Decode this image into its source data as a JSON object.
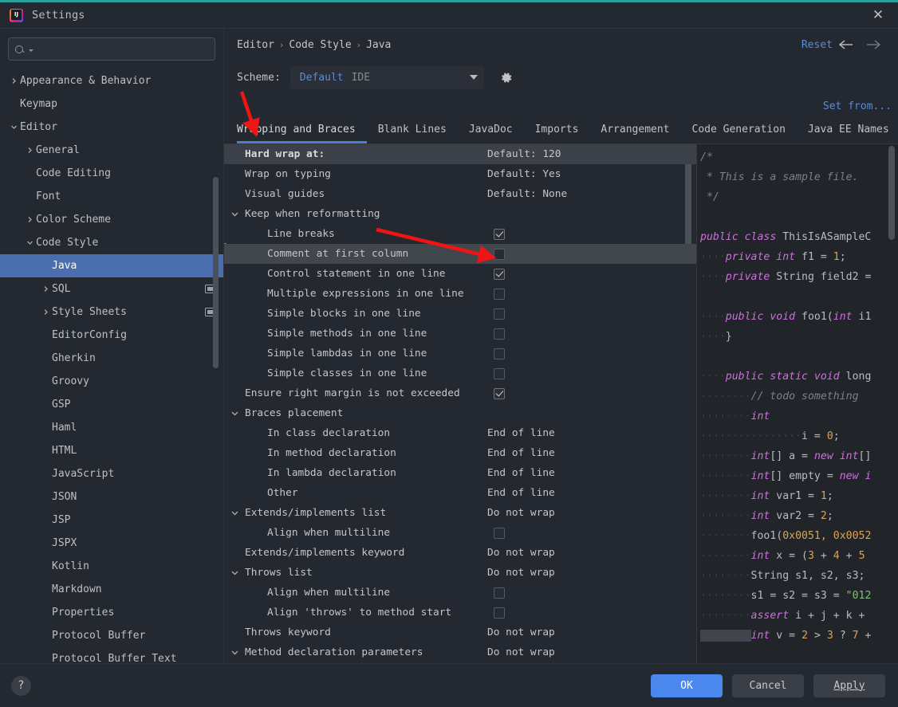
{
  "window": {
    "title": "Settings",
    "logo_icon": "intellij-idea-logo",
    "close_icon": "close-icon"
  },
  "sidebar": {
    "search": {
      "placeholder": "",
      "value": "",
      "icon": "search-icon"
    },
    "items": [
      {
        "label": "Appearance & Behavior",
        "indent": 0,
        "arrow": "right",
        "selected": false
      },
      {
        "label": "Keymap",
        "indent": 0,
        "arrow": "none",
        "selected": false
      },
      {
        "label": "Editor",
        "indent": 0,
        "arrow": "down",
        "selected": false
      },
      {
        "label": "General",
        "indent": 1,
        "arrow": "right",
        "selected": false
      },
      {
        "label": "Code Editing",
        "indent": 1,
        "arrow": "none",
        "selected": false
      },
      {
        "label": "Font",
        "indent": 1,
        "arrow": "none",
        "selected": false
      },
      {
        "label": "Color Scheme",
        "indent": 1,
        "arrow": "right",
        "selected": false
      },
      {
        "label": "Code Style",
        "indent": 1,
        "arrow": "down",
        "selected": false
      },
      {
        "label": "Java",
        "indent": 2,
        "arrow": "none",
        "selected": true
      },
      {
        "label": "SQL",
        "indent": 2,
        "arrow": "right",
        "selected": false,
        "badge": true
      },
      {
        "label": "Style Sheets",
        "indent": 2,
        "arrow": "right",
        "selected": false,
        "badge": true
      },
      {
        "label": "EditorConfig",
        "indent": 2,
        "arrow": "none",
        "selected": false
      },
      {
        "label": "Gherkin",
        "indent": 2,
        "arrow": "none",
        "selected": false
      },
      {
        "label": "Groovy",
        "indent": 2,
        "arrow": "none",
        "selected": false
      },
      {
        "label": "GSP",
        "indent": 2,
        "arrow": "none",
        "selected": false
      },
      {
        "label": "Haml",
        "indent": 2,
        "arrow": "none",
        "selected": false
      },
      {
        "label": "HTML",
        "indent": 2,
        "arrow": "none",
        "selected": false
      },
      {
        "label": "JavaScript",
        "indent": 2,
        "arrow": "none",
        "selected": false
      },
      {
        "label": "JSON",
        "indent": 2,
        "arrow": "none",
        "selected": false
      },
      {
        "label": "JSP",
        "indent": 2,
        "arrow": "none",
        "selected": false
      },
      {
        "label": "JSPX",
        "indent": 2,
        "arrow": "none",
        "selected": false
      },
      {
        "label": "Kotlin",
        "indent": 2,
        "arrow": "none",
        "selected": false
      },
      {
        "label": "Markdown",
        "indent": 2,
        "arrow": "none",
        "selected": false
      },
      {
        "label": "Properties",
        "indent": 2,
        "arrow": "none",
        "selected": false
      },
      {
        "label": "Protocol Buffer",
        "indent": 2,
        "arrow": "none",
        "selected": false
      },
      {
        "label": "Protocol Buffer Text",
        "indent": 2,
        "arrow": "none",
        "selected": false
      }
    ]
  },
  "header": {
    "breadcrumb": [
      "Editor",
      "Code Style",
      "Java"
    ],
    "separator": "›",
    "reset_label": "Reset",
    "back_icon": "arrow-left-icon",
    "forward_icon": "arrow-right-icon",
    "scheme_label": "Scheme:",
    "scheme_name": "Default",
    "scheme_scope": "IDE",
    "scheme_gear_icon": "gear-icon",
    "set_from_label": "Set from..."
  },
  "tabs": {
    "items": [
      {
        "label": "Wrapping and Braces",
        "active": true
      },
      {
        "label": "Blank Lines",
        "active": false
      },
      {
        "label": "JavaDoc",
        "active": false
      },
      {
        "label": "Imports",
        "active": false
      },
      {
        "label": "Arrangement",
        "active": false
      },
      {
        "label": "Code Generation",
        "active": false
      },
      {
        "label": "Java EE Names",
        "active": false
      }
    ],
    "more_icon": "chevron-down-icon"
  },
  "settings_rows": [
    {
      "label": "Hard wrap at:",
      "indent": 0,
      "twisty": "none",
      "value": "Default: 120",
      "control": "text",
      "state": "header-highlight",
      "bold": true
    },
    {
      "label": "Wrap on typing",
      "indent": 0,
      "twisty": "none",
      "value": "Default: Yes",
      "control": "text",
      "state": ""
    },
    {
      "label": "Visual guides",
      "indent": 0,
      "twisty": "none",
      "value": "Default: None",
      "control": "text",
      "state": ""
    },
    {
      "label": "Keep when reformatting",
      "indent": 0,
      "twisty": "down",
      "value": "",
      "control": "none",
      "state": ""
    },
    {
      "label": "Line breaks",
      "indent": 1,
      "twisty": "none",
      "value": "",
      "control": "checkbox",
      "checked": true,
      "state": ""
    },
    {
      "label": "Comment at first column",
      "indent": 1,
      "twisty": "none",
      "value": "",
      "control": "checkbox",
      "checked": false,
      "state": "row-selected"
    },
    {
      "label": "Control statement in one line",
      "indent": 1,
      "twisty": "none",
      "value": "",
      "control": "checkbox",
      "checked": true,
      "state": ""
    },
    {
      "label": "Multiple expressions in one line",
      "indent": 1,
      "twisty": "none",
      "value": "",
      "control": "checkbox",
      "checked": false,
      "state": ""
    },
    {
      "label": "Simple blocks in one line",
      "indent": 1,
      "twisty": "none",
      "value": "",
      "control": "checkbox",
      "checked": false,
      "state": ""
    },
    {
      "label": "Simple methods in one line",
      "indent": 1,
      "twisty": "none",
      "value": "",
      "control": "checkbox",
      "checked": false,
      "state": ""
    },
    {
      "label": "Simple lambdas in one line",
      "indent": 1,
      "twisty": "none",
      "value": "",
      "control": "checkbox",
      "checked": false,
      "state": ""
    },
    {
      "label": "Simple classes in one line",
      "indent": 1,
      "twisty": "none",
      "value": "",
      "control": "checkbox",
      "checked": false,
      "state": ""
    },
    {
      "label": "Ensure right margin is not exceeded",
      "indent": 0,
      "twisty": "none",
      "value": "",
      "control": "checkbox",
      "checked": true,
      "state": ""
    },
    {
      "label": "Braces placement",
      "indent": 0,
      "twisty": "down",
      "value": "",
      "control": "none",
      "state": ""
    },
    {
      "label": "In class declaration",
      "indent": 1,
      "twisty": "none",
      "value": "End of line",
      "control": "text",
      "state": ""
    },
    {
      "label": "In method declaration",
      "indent": 1,
      "twisty": "none",
      "value": "End of line",
      "control": "text",
      "state": ""
    },
    {
      "label": "In lambda declaration",
      "indent": 1,
      "twisty": "none",
      "value": "End of line",
      "control": "text",
      "state": ""
    },
    {
      "label": "Other",
      "indent": 1,
      "twisty": "none",
      "value": "End of line",
      "control": "text",
      "state": ""
    },
    {
      "label": "Extends/implements list",
      "indent": 0,
      "twisty": "down",
      "value": "Do not wrap",
      "control": "text",
      "state": ""
    },
    {
      "label": "Align when multiline",
      "indent": 1,
      "twisty": "none",
      "value": "",
      "control": "checkbox",
      "checked": false,
      "state": ""
    },
    {
      "label": "Extends/implements keyword",
      "indent": 0,
      "twisty": "none",
      "value": "Do not wrap",
      "control": "text",
      "state": ""
    },
    {
      "label": "Throws list",
      "indent": 0,
      "twisty": "down",
      "value": "Do not wrap",
      "control": "text",
      "state": ""
    },
    {
      "label": "Align when multiline",
      "indent": 1,
      "twisty": "none",
      "value": "",
      "control": "checkbox",
      "checked": false,
      "state": ""
    },
    {
      "label": "Align 'throws' to method start",
      "indent": 1,
      "twisty": "none",
      "value": "",
      "control": "checkbox",
      "checked": false,
      "state": ""
    },
    {
      "label": "Throws keyword",
      "indent": 0,
      "twisty": "none",
      "value": "Do not wrap",
      "control": "text",
      "state": ""
    },
    {
      "label": "Method declaration parameters",
      "indent": 0,
      "twisty": "down",
      "value": "Do not wrap",
      "control": "text",
      "state": ""
    }
  ],
  "preview": {
    "lines": [
      [
        {
          "t": "/*",
          "c": "cm"
        }
      ],
      [
        {
          "t": " * This is a sample file.",
          "c": "cm"
        }
      ],
      [
        {
          "t": " */",
          "c": "cm"
        }
      ],
      [
        {
          "t": "",
          "c": "pl"
        }
      ],
      [
        {
          "t": "public class ",
          "c": "k"
        },
        {
          "t": "ThisIsASampleC",
          "c": "pl"
        }
      ],
      [
        {
          "t": "····",
          "c": "dot"
        },
        {
          "t": "private int ",
          "c": "k"
        },
        {
          "t": "f1 = ",
          "c": "pl"
        },
        {
          "t": "1",
          "c": "num"
        },
        {
          "t": ";",
          "c": "pl"
        }
      ],
      [
        {
          "t": "····",
          "c": "dot"
        },
        {
          "t": "private ",
          "c": "k"
        },
        {
          "t": "String field2 =",
          "c": "pl"
        }
      ],
      [
        {
          "t": "",
          "c": "pl"
        }
      ],
      [
        {
          "t": "····",
          "c": "dot"
        },
        {
          "t": "public void ",
          "c": "k"
        },
        {
          "t": "foo1(",
          "c": "pl"
        },
        {
          "t": "int ",
          "c": "k"
        },
        {
          "t": "i1",
          "c": "pl"
        }
      ],
      [
        {
          "t": "····",
          "c": "dot"
        },
        {
          "t": "}",
          "c": "pl"
        }
      ],
      [
        {
          "t": "",
          "c": "pl"
        }
      ],
      [
        {
          "t": "····",
          "c": "dot"
        },
        {
          "t": "public static void ",
          "c": "k"
        },
        {
          "t": "long",
          "c": "pl"
        }
      ],
      [
        {
          "t": "········",
          "c": "dot"
        },
        {
          "t": "// todo something",
          "c": "cm"
        }
      ],
      [
        {
          "t": "········",
          "c": "dot"
        },
        {
          "t": "int",
          "c": "k"
        }
      ],
      [
        {
          "t": "················",
          "c": "dot"
        },
        {
          "t": "i = ",
          "c": "pl"
        },
        {
          "t": "0",
          "c": "num"
        },
        {
          "t": ";",
          "c": "pl"
        }
      ],
      [
        {
          "t": "········",
          "c": "dot"
        },
        {
          "t": "int",
          "c": "k"
        },
        {
          "t": "[] a = ",
          "c": "pl"
        },
        {
          "t": "new int",
          "c": "k"
        },
        {
          "t": "[]",
          "c": "pl"
        }
      ],
      [
        {
          "t": "········",
          "c": "dot"
        },
        {
          "t": "int",
          "c": "k"
        },
        {
          "t": "[] empty = ",
          "c": "pl"
        },
        {
          "t": "new i",
          "c": "k"
        }
      ],
      [
        {
          "t": "········",
          "c": "dot"
        },
        {
          "t": "int ",
          "c": "k"
        },
        {
          "t": "var1 = ",
          "c": "pl"
        },
        {
          "t": "1",
          "c": "num"
        },
        {
          "t": ";",
          "c": "pl"
        }
      ],
      [
        {
          "t": "········",
          "c": "dot"
        },
        {
          "t": "int ",
          "c": "k"
        },
        {
          "t": "var2 = ",
          "c": "pl"
        },
        {
          "t": "2",
          "c": "num"
        },
        {
          "t": ";",
          "c": "pl"
        }
      ],
      [
        {
          "t": "········",
          "c": "dot"
        },
        {
          "t": "foo1(",
          "c": "pl"
        },
        {
          "t": "0x0051, 0x0052",
          "c": "num"
        }
      ],
      [
        {
          "t": "········",
          "c": "dot"
        },
        {
          "t": "int ",
          "c": "k"
        },
        {
          "t": "x = (",
          "c": "pl"
        },
        {
          "t": "3",
          "c": "num"
        },
        {
          "t": " + ",
          "c": "pl"
        },
        {
          "t": "4",
          "c": "num"
        },
        {
          "t": " + ",
          "c": "pl"
        },
        {
          "t": "5",
          "c": "num"
        }
      ],
      [
        {
          "t": "········",
          "c": "dot"
        },
        {
          "t": "String s1, s2, s3;",
          "c": "pl"
        }
      ],
      [
        {
          "t": "········",
          "c": "dot"
        },
        {
          "t": "s1 = s2 = s3 = ",
          "c": "pl"
        },
        {
          "t": "\"012",
          "c": "str"
        }
      ],
      [
        {
          "t": "········",
          "c": "dot"
        },
        {
          "t": "assert ",
          "c": "k"
        },
        {
          "t": "i + j + k + ",
          "c": "pl"
        }
      ],
      [
        {
          "t": "········",
          "c": "dot",
          "sel": true
        },
        {
          "t": "int ",
          "c": "k"
        },
        {
          "t": "v = ",
          "c": "pl"
        },
        {
          "t": "2",
          "c": "num"
        },
        {
          "t": " > ",
          "c": "pl"
        },
        {
          "t": "3",
          "c": "num"
        },
        {
          "t": " ? ",
          "c": "pl"
        },
        {
          "t": "7",
          "c": "num"
        },
        {
          "t": " +",
          "c": "pl"
        }
      ]
    ]
  },
  "footer": {
    "help_icon": "help-icon",
    "help_label": "?",
    "ok_label": "OK",
    "cancel_label": "Cancel",
    "apply_label": "Apply"
  },
  "annotations": {
    "arrow_color": "#f01515",
    "arrow1": {
      "name": "arrow-to-wrapping-tab"
    },
    "arrow2": {
      "name": "arrow-to-comment-checkbox"
    }
  },
  "colors": {
    "accent_blue": "#4b7fd6",
    "selection_blue": "#4b6eaf",
    "link_blue": "#5a8cd8",
    "top_accent": "#2aa198",
    "window_bg": "#242830",
    "primary_button": "#4a88ee"
  }
}
